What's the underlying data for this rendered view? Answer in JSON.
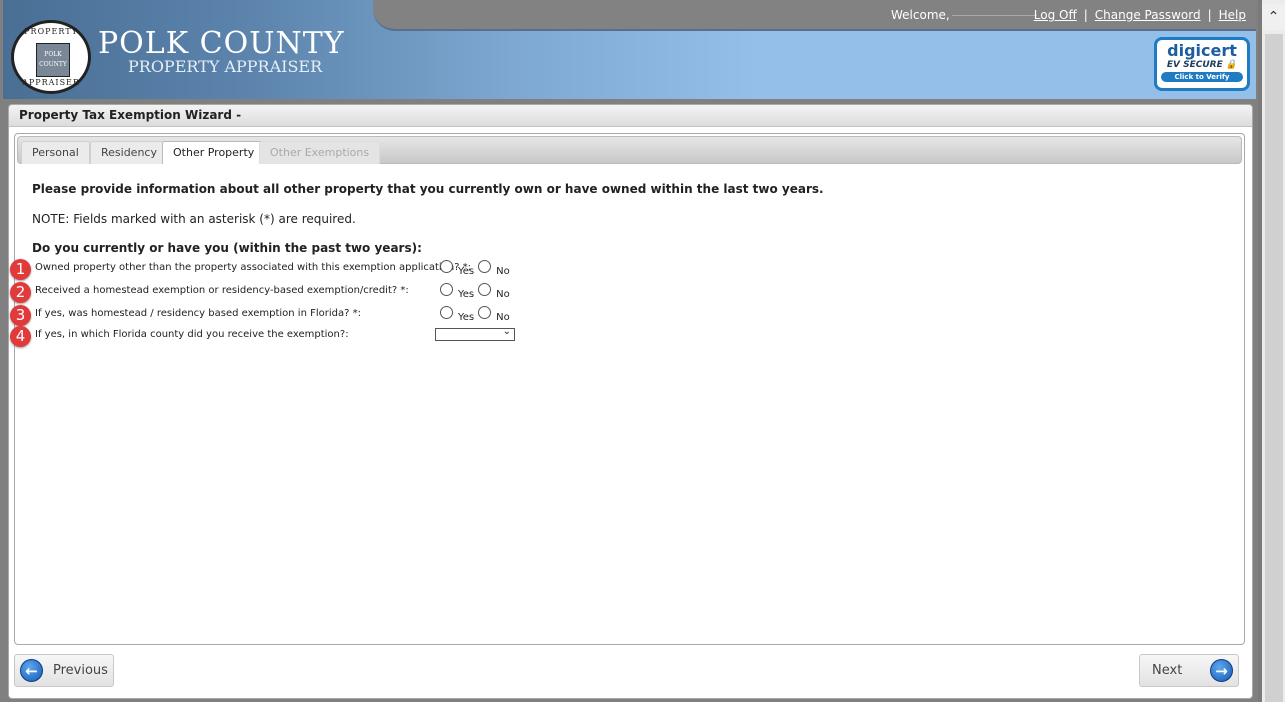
{
  "header": {
    "logo_title": "POLK COUNTY",
    "logo_subtitle": "PROPERTY APPRAISER",
    "seal_top": "PROPERTY",
    "seal_bottom": "APPRAISER",
    "seal_center_1": "POLK",
    "seal_center_2": "COUNTY",
    "welcome": "Welcome,",
    "links": {
      "logoff": "Log Off",
      "change_password": "Change Password",
      "help": "Help"
    },
    "separator": "|",
    "digicert": {
      "brand": "digicert",
      "ev": "EV SECURE 🔒",
      "verify": "Click to Verify"
    }
  },
  "wizard": {
    "title": "Property Tax Exemption Wizard -",
    "tabs": [
      {
        "label": "Personal",
        "state": "enabled"
      },
      {
        "label": "Residency",
        "state": "enabled"
      },
      {
        "label": "Other Property",
        "state": "active"
      },
      {
        "label": "Other Exemptions",
        "state": "disabled"
      }
    ],
    "intro": "Please provide information about all other property that you currently own or have owned within the last two years.",
    "note": "NOTE: Fields marked with an asterisk (*) are required.",
    "question_heading": "Do you currently or have you (within the past two years):",
    "questions": [
      {
        "number": "1",
        "label": "Owned property other than the property associated with this exemption application? *:",
        "type": "radio",
        "options": [
          "Yes",
          "No"
        ],
        "selected": null
      },
      {
        "number": "2",
        "label": "Received a homestead exemption or residency-based exemption/credit? *:",
        "type": "radio",
        "options": [
          "Yes",
          "No"
        ],
        "selected": null
      },
      {
        "number": "3",
        "label": "If yes, was homestead / residency based exemption in Florida? *:",
        "type": "radio",
        "options": [
          "Yes",
          "No"
        ],
        "selected": null
      },
      {
        "number": "4",
        "label": "If yes, in which Florida county did you receive the exemption?:",
        "type": "select",
        "value": ""
      }
    ],
    "buttons": {
      "previous": "Previous",
      "next": "Next"
    }
  },
  "icons": {
    "prev_arrow": "←",
    "next_arrow": "→",
    "scroll_up": "⌃",
    "select_chevron": "⌄"
  }
}
